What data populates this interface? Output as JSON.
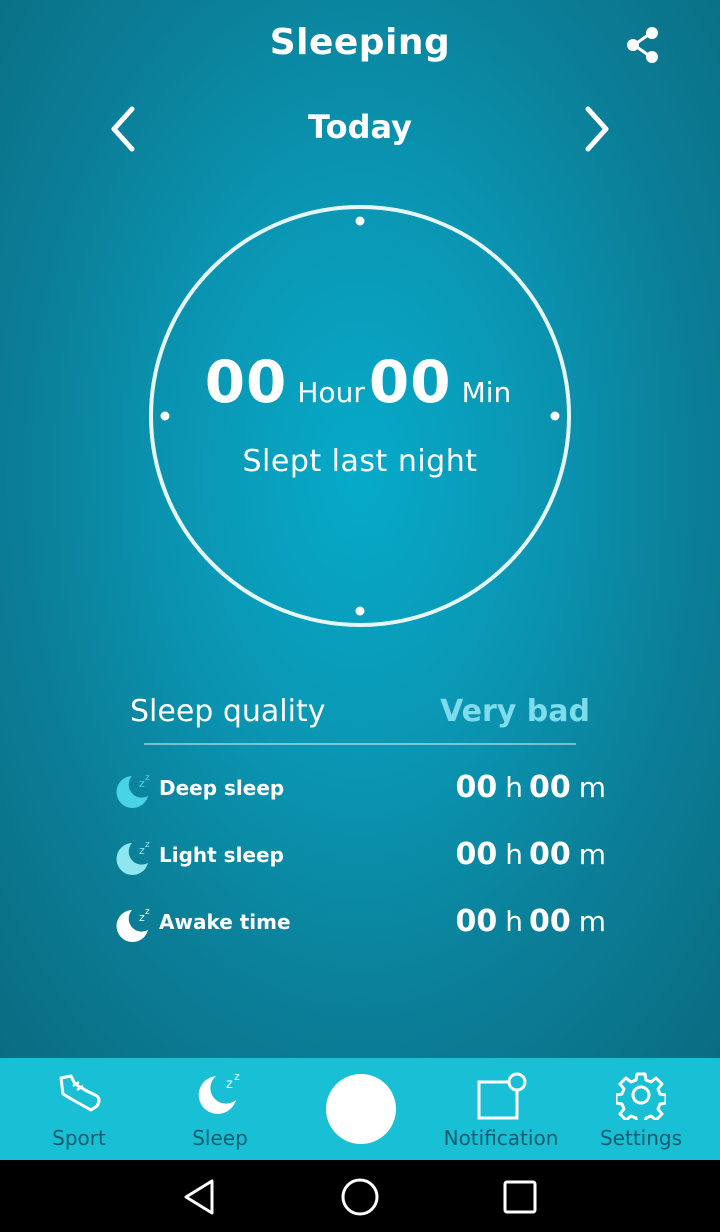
{
  "header": {
    "title": "Sleeping",
    "date": "Today"
  },
  "icons": {
    "share": "share-icon",
    "prev": "chevron-left-icon",
    "next": "chevron-right-icon"
  },
  "dial": {
    "hours": "00",
    "hour_unit": "Hour",
    "minutes": "00",
    "minute_unit": "Min",
    "subtitle": "Slept last night"
  },
  "quality": {
    "label": "Sleep quality",
    "value": "Very bad",
    "value_color": "#7fdcec"
  },
  "metrics": [
    {
      "label": "Deep sleep",
      "hours": "00",
      "h_unit": "h",
      "minutes": "00",
      "m_unit": "m",
      "icon": "moon-zz-icon",
      "icon_color": "#49d3e6"
    },
    {
      "label": "Light sleep",
      "hours": "00",
      "h_unit": "h",
      "minutes": "00",
      "m_unit": "m",
      "icon": "moon-zz-icon",
      "icon_color": "#8fe6f0"
    },
    {
      "label": "Awake time",
      "hours": "00",
      "h_unit": "h",
      "minutes": "00",
      "m_unit": "m",
      "icon": "moon-zz-icon",
      "icon_color": "#ffffff"
    }
  ],
  "tabs": [
    {
      "label": "Sport",
      "icon": "shoe-icon"
    },
    {
      "label": "Sleep",
      "icon": "moon-zz-icon"
    },
    {
      "label": "Notification",
      "icon": "notification-icon"
    },
    {
      "label": "Settings",
      "icon": "gear-icon"
    }
  ],
  "colors": {
    "background": "#0a96b3",
    "tabbar": "#19bfd5",
    "tab_label": "#0f5c6c"
  }
}
